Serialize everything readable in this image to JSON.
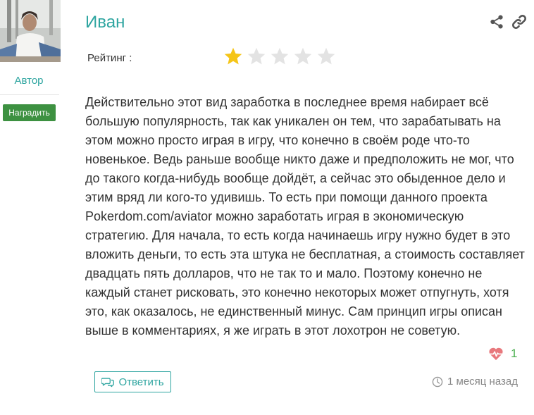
{
  "author_panel": {
    "role_label": "Автор",
    "award_button": "Наградить"
  },
  "comment": {
    "username": "Иван",
    "rating_label": "Рейтинг :",
    "rating": {
      "value": 1,
      "max": 5
    },
    "text": "Действительно этот вид заработка в последнее время набирает всё большую популярность, так как уникален он тем, что зарабатывать на этом можно просто играя в игру, что конечно в своём роде что-то новенькое. Ведь раньше вообще никто даже и предположить не мог, что до такого когда-нибудь вообще дойдёт, а сейчас это обыденное дело и этим вряд ли кого-то удивишь. То есть при помощи данного проекта Pokerdom.com/aviator можно заработать играя в экономическую стратегию. Для начала, то есть когда начинаешь игру нужно будет в это вложить деньги, то есть эта штука не бесплатная, а стоимость составляет двадцать пять долларов, что не так то и мало. Поэтому конечно не каждый станет рисковать, это конечно некоторых может отпугнуть, хотя это, как оказалось, не единственный минус. Сам принцип игры описан выше в комментариях, я же играть в этот лохотрон не советую.",
    "likes": "1",
    "reply_button": "Ответить",
    "timestamp": "1 месяц назад"
  },
  "icons": {
    "share": "share-icon",
    "link": "link-icon",
    "heart": "heart-pulse-icon",
    "reply": "comments-icon",
    "clock": "clock-icon",
    "star": "star-icon"
  },
  "colors": {
    "accent": "#2ea5a0",
    "award_button": "#3d9141",
    "star_active": "#f5c518",
    "star_inactive": "#e3e3e3",
    "like_count": "#4caf50",
    "heart": "#e8787d"
  }
}
